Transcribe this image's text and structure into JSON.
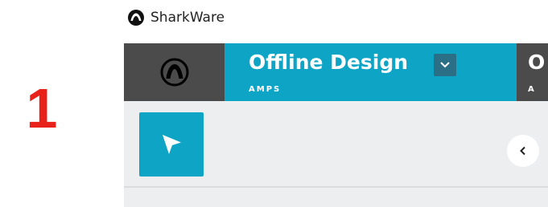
{
  "step": {
    "number": "1"
  },
  "window": {
    "app_name": "SharkWare"
  },
  "header": {
    "logo_icon": "sharkware-logo-icon",
    "tabs": [
      {
        "title": "Offline Design",
        "subtitle": "AMPS",
        "active": true
      },
      {
        "title": "O",
        "subtitle": "A",
        "active": false
      }
    ]
  },
  "toolbar": {
    "select_tool_icon": "cursor-arrow-icon",
    "collapse_icon": "chevron-left-icon"
  },
  "colors": {
    "accent": "#0ea4c6",
    "dark": "#4b4b4b",
    "step_marker": "#e8211a",
    "toolbar_bg": "#edeef0"
  }
}
